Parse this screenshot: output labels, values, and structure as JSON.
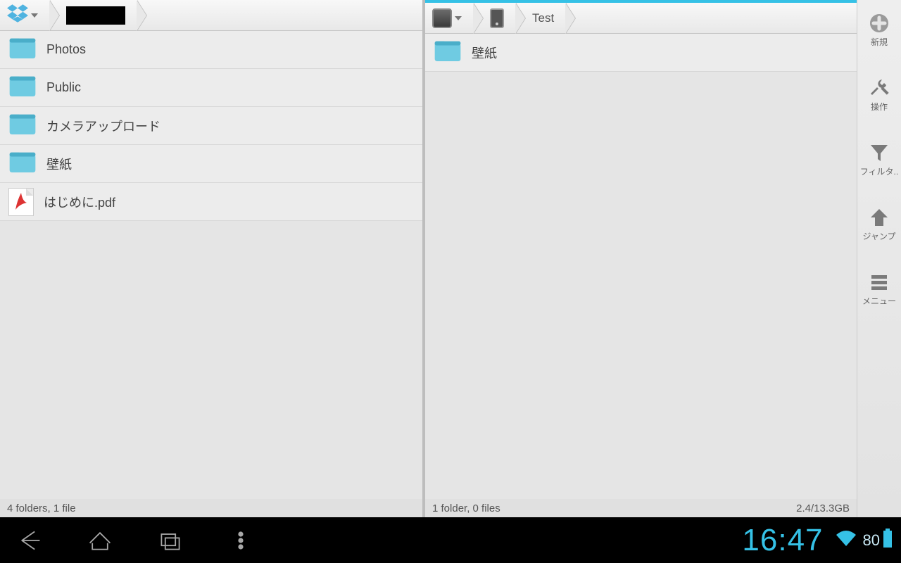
{
  "left": {
    "crumbs": [
      {
        "type": "dropbox"
      },
      {
        "type": "redacted"
      }
    ],
    "items": [
      {
        "kind": "folder",
        "label": "Photos"
      },
      {
        "kind": "folder",
        "label": "Public"
      },
      {
        "kind": "folder",
        "label": "カメラアップロード"
      },
      {
        "kind": "folder",
        "label": "壁紙"
      },
      {
        "kind": "pdf",
        "label": "はじめに.pdf"
      }
    ],
    "status": "4 folders, 1 file"
  },
  "right": {
    "crumbs": [
      {
        "type": "device"
      },
      {
        "type": "tablet"
      },
      {
        "type": "text",
        "label": "Test"
      }
    ],
    "items": [
      {
        "kind": "folder",
        "label": "壁紙"
      }
    ],
    "status": "1 folder, 0 files",
    "storage": "2.4/13.3GB"
  },
  "sidebar": [
    {
      "name": "new",
      "label": "新規",
      "icon": "plus"
    },
    {
      "name": "action",
      "label": "操作",
      "icon": "tools"
    },
    {
      "name": "filter",
      "label": "フィルタ..",
      "icon": "funnel"
    },
    {
      "name": "jump",
      "label": "ジャンプ",
      "icon": "up"
    },
    {
      "name": "menu",
      "label": "メニュー",
      "icon": "menu"
    }
  ],
  "navbar": {
    "time": "16:47",
    "battery": "80"
  }
}
